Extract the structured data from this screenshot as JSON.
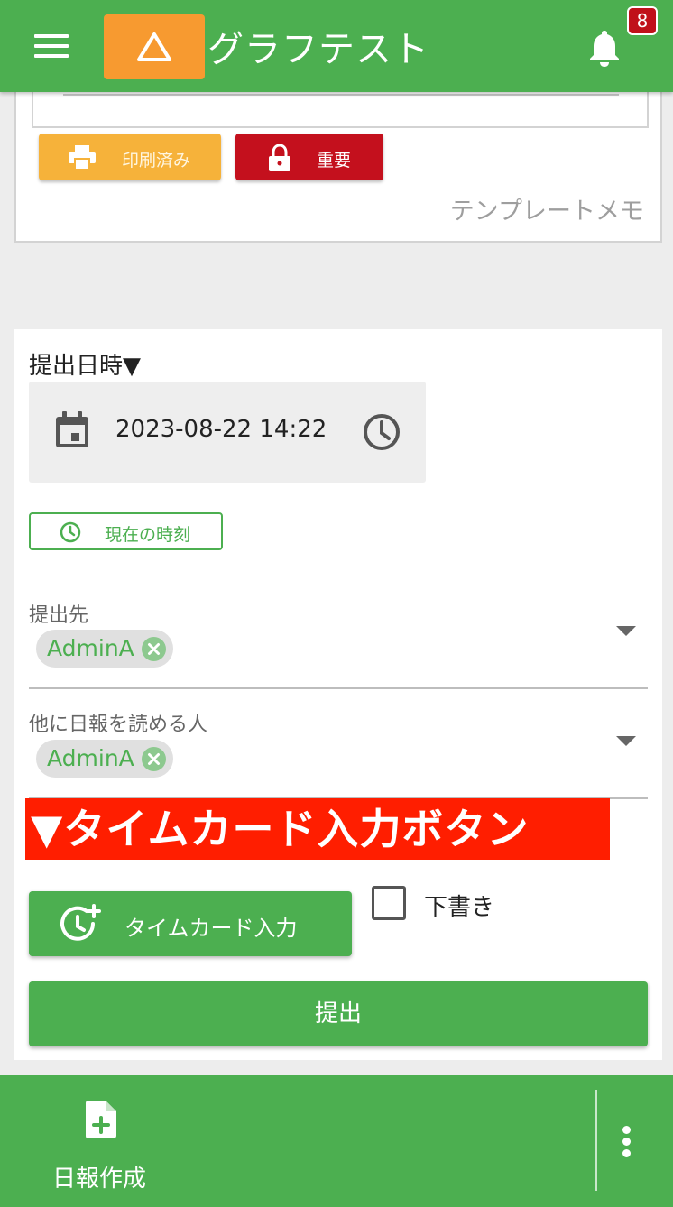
{
  "header": {
    "title": "グラフテスト",
    "notification_count": "8"
  },
  "top_card": {
    "printed_label": "印刷済み",
    "important_label": "重要",
    "template_memo_label": "テンプレートメモ"
  },
  "form": {
    "submit_datetime_label": "提出日時▼",
    "datetime_value": "2023-08-22 14:22",
    "now_button_label": "現在の時刻",
    "recipient_label": "提出先",
    "recipient_chip": "AdminA",
    "readers_label": "他に日報を読める人",
    "readers_chip": "AdminA",
    "timecard_button_label": "タイムカード入力",
    "draft_label": "下書き",
    "draft_checked": false,
    "submit_label": "提出"
  },
  "annotation_banner": "▼タイムカード入力ボタン",
  "bottom_nav": {
    "create_report_label": "日報作成"
  },
  "colors": {
    "primary_green": "#4caf50",
    "logo_orange": "#f79a30",
    "print_orange": "#f6b23a",
    "important_red": "#c4101d",
    "banner_red": "#ff1e00",
    "badge_red": "#c0111a"
  },
  "icons": [
    "menu-icon",
    "warning-triangle-icon",
    "bell-icon",
    "printer-icon",
    "lock-icon",
    "calendar-icon",
    "clock-icon",
    "close-icon",
    "chevron-down-icon",
    "clock-plus-icon",
    "file-plus-icon",
    "more-vertical-icon"
  ]
}
